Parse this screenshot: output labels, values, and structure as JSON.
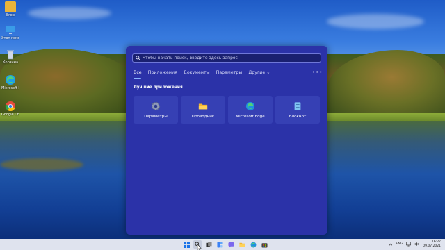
{
  "desktop": {
    "icons": [
      {
        "label": "Егор",
        "icon": "user-folder-icon",
        "color": "#e9b43a"
      },
      {
        "label": "Этот компьютер",
        "icon": "computer-icon",
        "color": "#3a9be8"
      },
      {
        "label": "Корзина",
        "icon": "recycle-bin-icon",
        "color": "#cfd8e6"
      },
      {
        "label": "Microsoft Edge",
        "icon": "edge-icon",
        "color": "#1fa0e6"
      },
      {
        "label": "Google Chrome",
        "icon": "chrome-icon",
        "color": "#e74c3c"
      }
    ]
  },
  "search_panel": {
    "search_placeholder": "Чтобы начать поиск, введите здесь запрос",
    "tabs": [
      {
        "label": "Все",
        "active": true
      },
      {
        "label": "Приложения"
      },
      {
        "label": "Документы"
      },
      {
        "label": "Параметры"
      },
      {
        "label": "Другие ⌄"
      }
    ],
    "more_label": "•••",
    "section_title": "Лучшие приложения",
    "top_apps": [
      {
        "label": "Параметры",
        "icon": "settings-gear-icon"
      },
      {
        "label": "Проводник",
        "icon": "file-explorer-icon"
      },
      {
        "label": "Microsoft Edge",
        "icon": "edge-icon"
      },
      {
        "label": "Блокнот",
        "icon": "notepad-icon"
      }
    ]
  },
  "taskbar": {
    "items": [
      "start-icon",
      "search-icon",
      "task-view-icon",
      "widgets-icon",
      "chat-icon",
      "file-explorer-icon",
      "edge-icon",
      "store-icon"
    ],
    "language": "ENG",
    "time": "16:27",
    "date": "09.07.2021"
  },
  "colors": {
    "panel_bg": "#2b32a8",
    "tile_bg": "#3640b4",
    "accent": "#8ab4ff",
    "taskbar_bg": "#dfe3ee"
  }
}
